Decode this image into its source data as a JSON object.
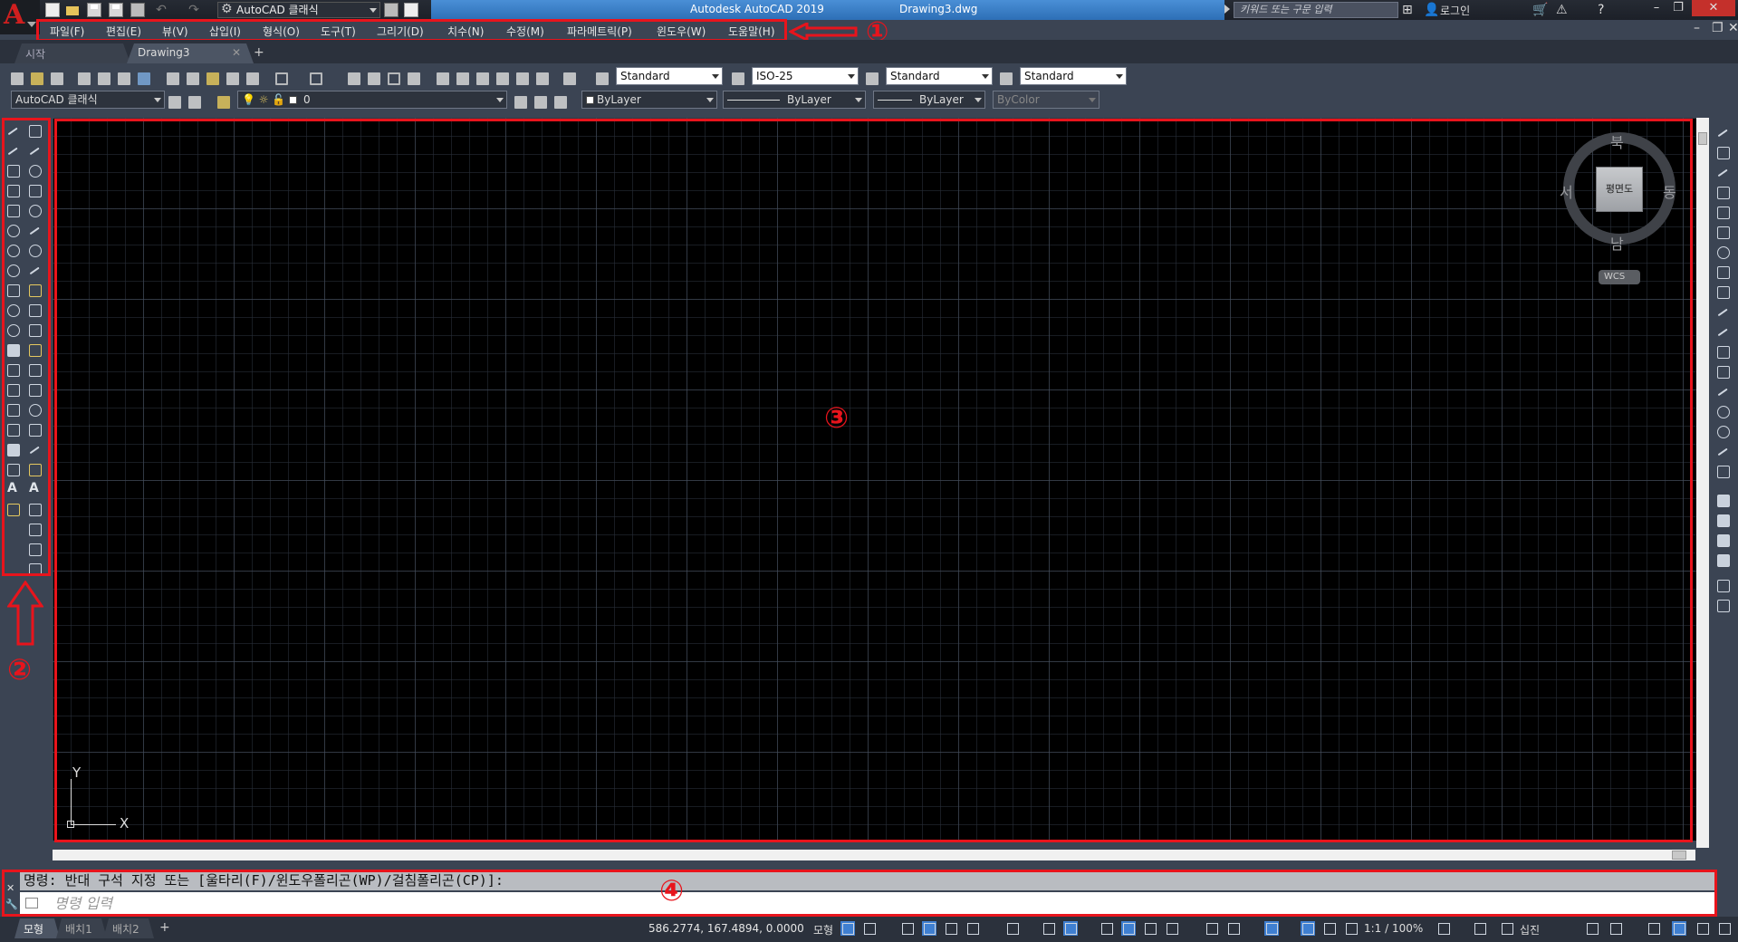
{
  "title_bar": {
    "workspace": "AutoCAD 클래식",
    "app_title": "Autodesk AutoCAD 2019",
    "file_name": "Drawing3.dwg",
    "search_placeholder": "키워드 또는 구문 입력",
    "login": "로그인"
  },
  "menu": {
    "items": [
      "파일(F)",
      "편집(E)",
      "뷰(V)",
      "삽입(I)",
      "형식(O)",
      "도구(T)",
      "그리기(D)",
      "치수(N)",
      "수정(M)",
      "파라메트릭(P)",
      "윈도우(W)",
      "도움말(H)"
    ]
  },
  "tabs": {
    "start": "시작",
    "drawing": "Drawing3",
    "add": "+"
  },
  "toolbar_styles": {
    "text_style": "Standard",
    "dim_style": "ISO-25",
    "table_style": "Standard",
    "multileader_style": "Standard"
  },
  "toolbar_layers": {
    "workspace": "AutoCAD 클래식",
    "layer": "0",
    "color": "ByLayer",
    "linetype": "ByLayer",
    "lineweight": "ByLayer",
    "plot_style": "ByColor"
  },
  "viewcube": {
    "north": "북",
    "south": "남",
    "east": "동",
    "west": "서",
    "face": "평면도",
    "wcs": "WCS"
  },
  "ucs": {
    "x": "X",
    "y": "Y"
  },
  "annotations": {
    "one": "①",
    "two": "②",
    "three": "③",
    "four": "④",
    "color": "#e8141c"
  },
  "command": {
    "history": "명령: 반대 구석 지정 또는 [울타리(F)/윈도우폴리곤(WP)/걸침폴리곤(CP)]:",
    "placeholder": "명령 입력"
  },
  "status": {
    "layout_tabs": [
      "모형",
      "배치1",
      "배치2"
    ],
    "add": "+",
    "coords": "586.2774, 167.4894, 0.0000",
    "model_label": "모형",
    "scale": "1:1 / 100%",
    "units": "십진"
  },
  "colors": {
    "canvas_bg": "#000000",
    "ui_bg": "#3b4453",
    "title_blue": "#2d6fb6",
    "logo_red": "#d01f1f"
  }
}
